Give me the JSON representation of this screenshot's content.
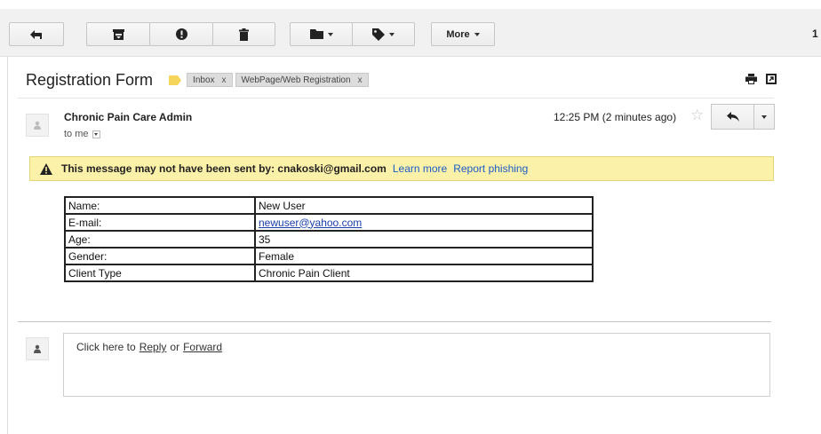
{
  "toolbar": {
    "back_icon": "arrow-left-icon",
    "archive_icon": "archive-icon",
    "spam_icon": "report-spam-icon",
    "delete_icon": "trash-icon",
    "move_icon": "folder-icon",
    "labels_icon": "label-tag-icon",
    "more_label": "More",
    "page_count": "1"
  },
  "message": {
    "subject": "Registration Form",
    "importance_color": "#f6d55c",
    "labels": [
      {
        "name": "Inbox",
        "remove": "x"
      },
      {
        "name": "WebPage/Web Registration",
        "remove": "x"
      }
    ],
    "sender": "Chronic Pain Care Admin",
    "to": "to me",
    "time": "12:25 PM (2 minutes ago)",
    "warning": {
      "text": "This message may not have been sent by: cnakoski@gmail.com",
      "learn_more": "Learn more",
      "report": "Report phishing",
      "bg": "#fcf1a8"
    }
  },
  "form": {
    "rows": [
      {
        "label": "Name:",
        "value": "New User"
      },
      {
        "label": "E-mail:",
        "value": "newuser@yahoo.com"
      },
      {
        "label": "Age:",
        "value": "35"
      },
      {
        "label": "Gender:",
        "value": "Female"
      },
      {
        "label": "Client Type",
        "value": "Chronic Pain Client"
      }
    ]
  },
  "reply": {
    "prefix": "Click here to",
    "reply_link": "Reply",
    "or": "or",
    "forward_link": "Forward"
  }
}
